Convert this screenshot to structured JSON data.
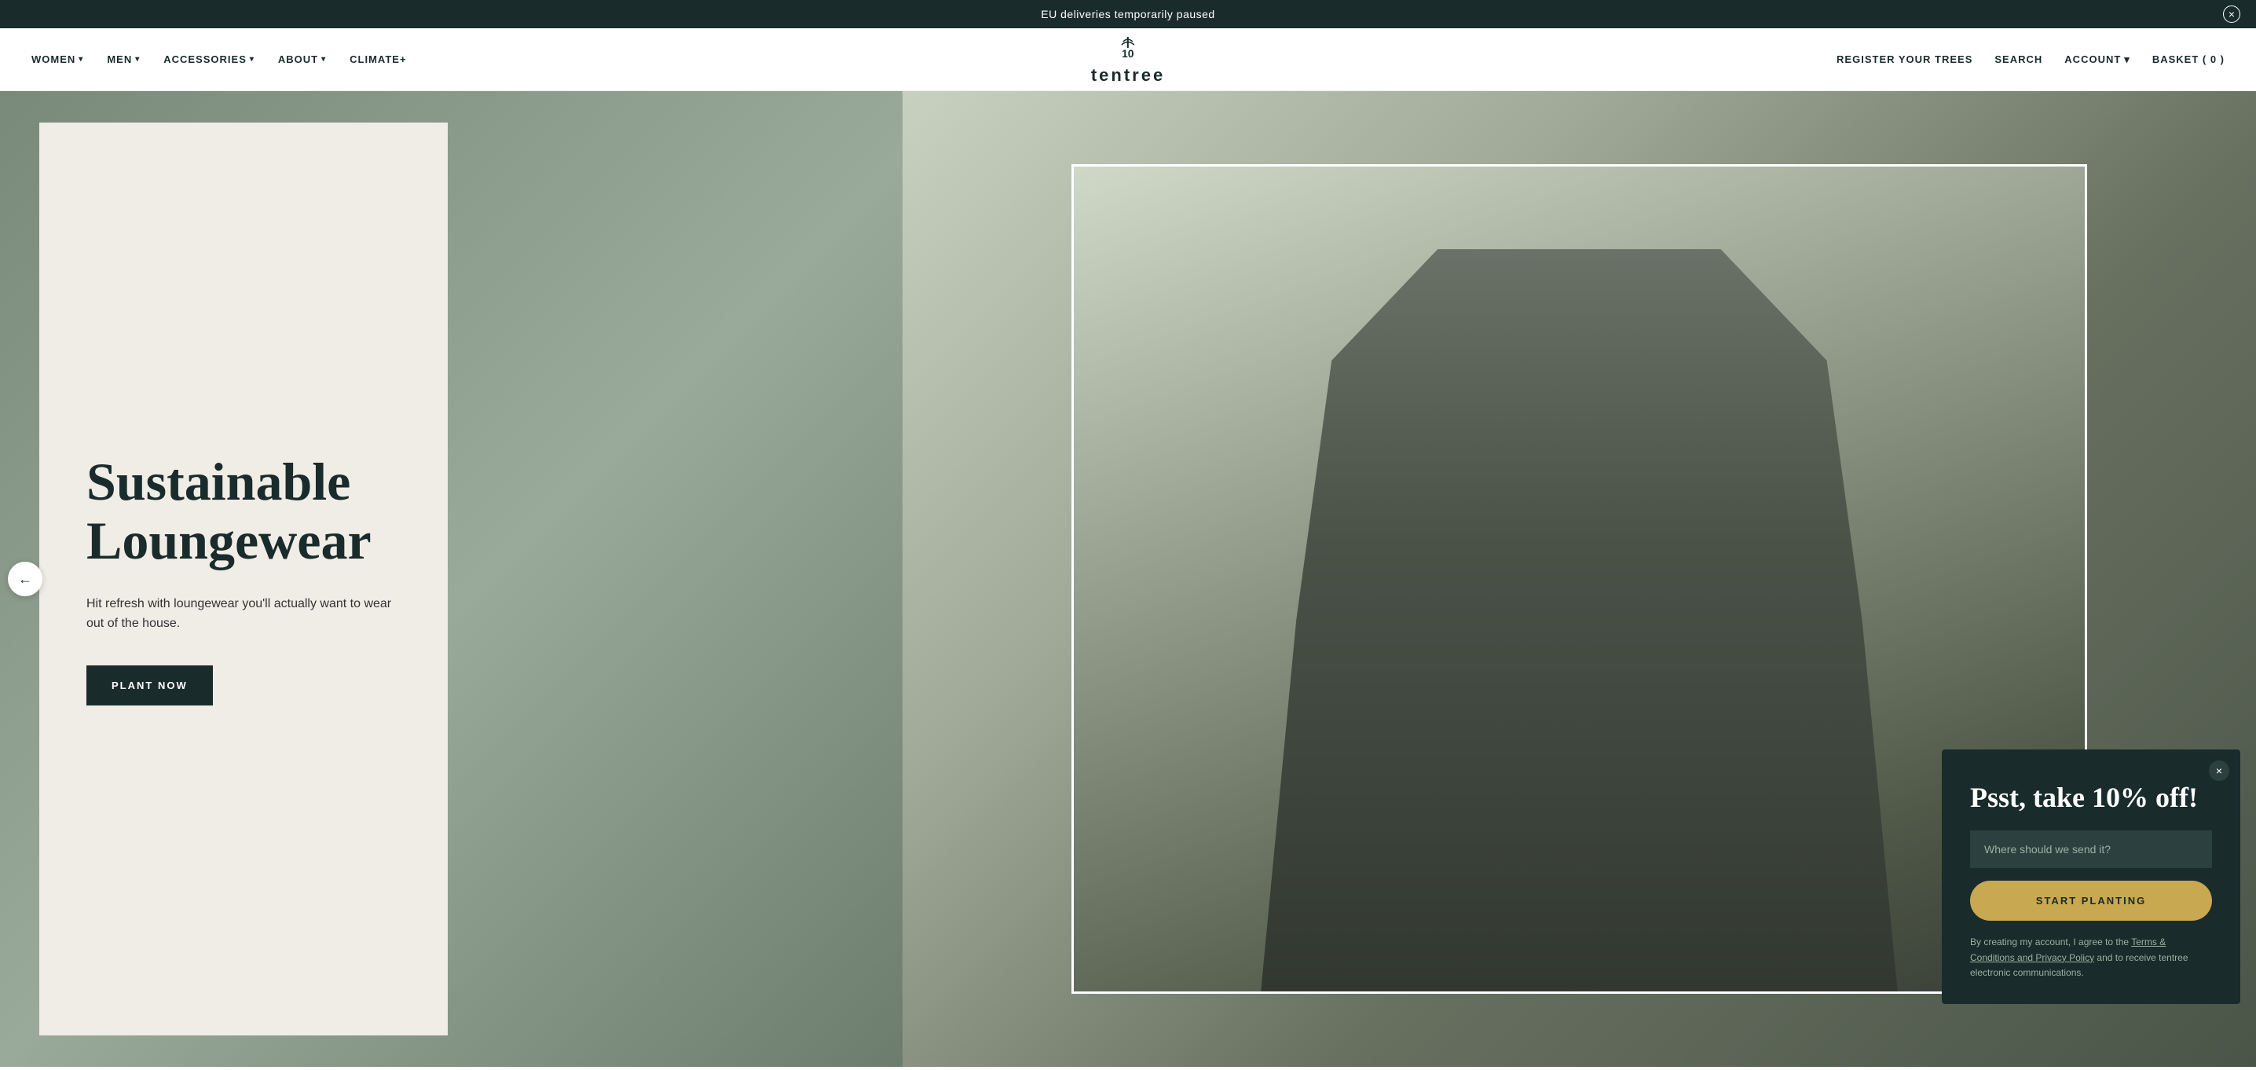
{
  "announcement": {
    "text": "EU deliveries temporarily paused",
    "close_label": "×"
  },
  "header": {
    "nav_left": [
      {
        "label": "WOMEN",
        "has_dropdown": true
      },
      {
        "label": "MEN",
        "has_dropdown": true
      },
      {
        "label": "ACCESSORIES",
        "has_dropdown": true
      },
      {
        "label": "ABOUT",
        "has_dropdown": true
      },
      {
        "label": "CLIMATE+",
        "has_dropdown": false
      }
    ],
    "logo": {
      "number": "10",
      "brand": "tentree",
      "icon": "🌲"
    },
    "nav_right": [
      {
        "label": "REGISTER YOUR TREES",
        "has_dropdown": false
      },
      {
        "label": "SEARCH",
        "has_dropdown": false
      },
      {
        "label": "ACCOUNT",
        "has_dropdown": true
      },
      {
        "label": "BASKET ( 0 )",
        "has_dropdown": false
      }
    ]
  },
  "hero": {
    "title_line1": "Sustainable",
    "title_line2": "Loungewear",
    "subtitle": "Hit refresh with loungewear you'll actually want to wear out of the house.",
    "cta_label": "PLANT NOW",
    "prev_arrow": "←"
  },
  "popup": {
    "title": "Psst, take 10% off!",
    "input_placeholder": "Where should we send it?",
    "cta_label": "START PLANTING",
    "legal_prefix": "By creating my account, I agree to the",
    "legal_link": "Terms & Conditions and Privacy Policy",
    "legal_suffix": "and to receive tentree electronic communications.",
    "close_label": "×"
  }
}
